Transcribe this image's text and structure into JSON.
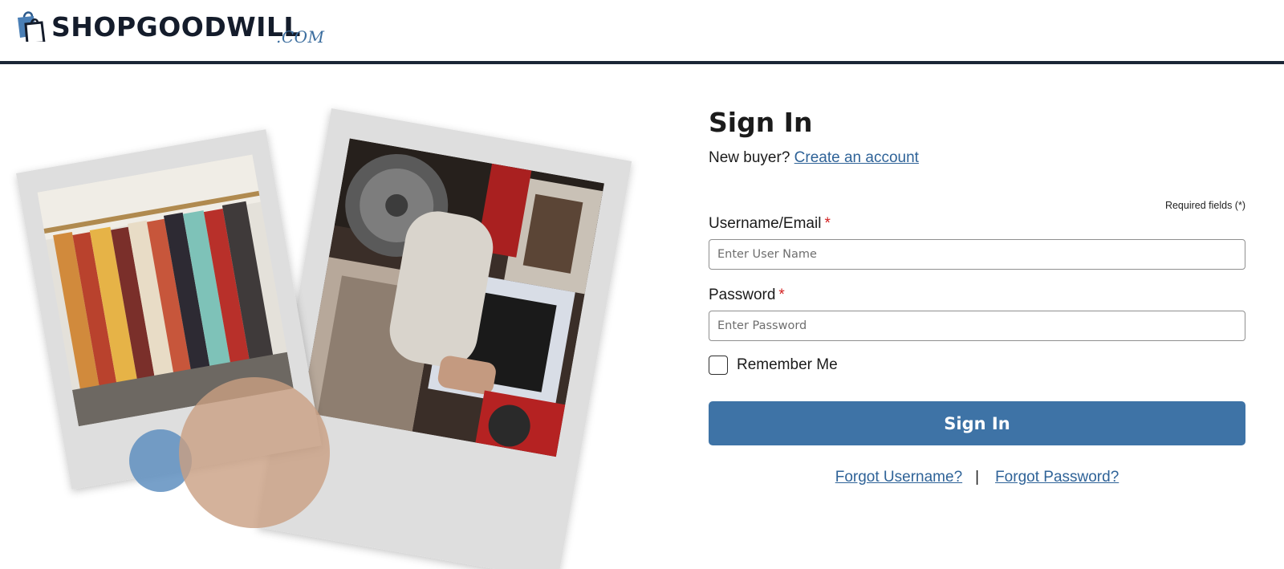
{
  "header": {
    "logo_text": "SHOPGOODWILL",
    "logo_suffix": ".COM",
    "brand_colors": {
      "navy": "#141c2b",
      "blue": "#3c6e9f"
    }
  },
  "illustration": {
    "left_photo": "clothing-rack-photo",
    "right_photo": "vinyl-records-photo",
    "circles": {
      "blue": "#5f8fc0",
      "tan": "#c99f82"
    }
  },
  "signin": {
    "title": "Sign In",
    "new_buyer_prefix": "New buyer?",
    "create_account_link": "Create an account",
    "required_note": "Required fields (*)",
    "username_label": "Username/Email",
    "username_placeholder": "Enter User Name",
    "username_value": "",
    "password_label": "Password",
    "password_placeholder": "Enter Password",
    "password_value": "",
    "required_marker": "*",
    "remember_label": "Remember Me",
    "remember_checked": false,
    "submit_label": "Sign In",
    "forgot_username": "Forgot Username?",
    "separator": "|",
    "forgot_password": "Forgot Password?",
    "accent_color": "#3e73a6",
    "link_color": "#2f6398"
  }
}
